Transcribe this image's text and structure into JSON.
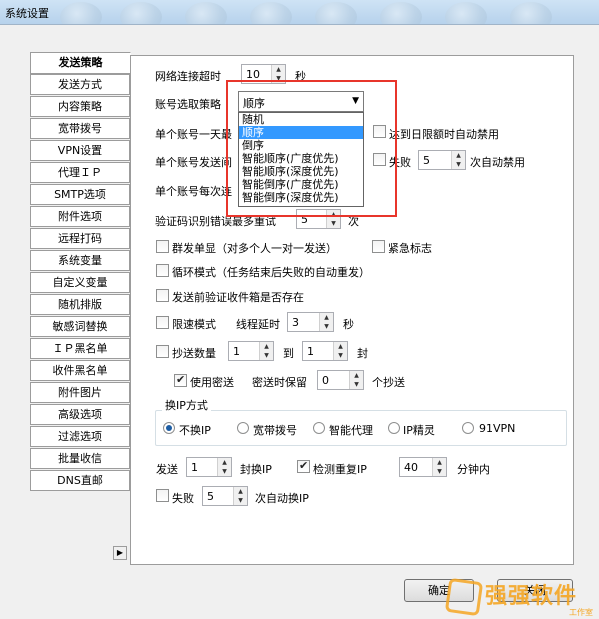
{
  "window": {
    "title": "系统设置"
  },
  "tabs": [
    "发送策略",
    "发送方式",
    "内容策略",
    "宽带拨号",
    "VPN设置",
    "代理ＩＰ",
    "SMTP选项",
    "附件选项",
    "远程打码",
    "系统变量",
    "自定义变量",
    "随机排版",
    "敏感词替换",
    "ＩＰ黑名单",
    "收件黑名单",
    "附件图片",
    "高级选项",
    "过滤选项",
    "批量收信",
    "DNS直邮"
  ],
  "tabs_scroll_icon": "▶",
  "form": {
    "timeout_label": "网络连接超时",
    "timeout_value": "10",
    "timeout_unit": "秒",
    "account_strategy_label": "账号选取策略",
    "account_strategy_value": "顺序",
    "account_strategy_options": [
      "随机",
      "顺序",
      "倒序",
      "智能顺序(广度优先)",
      "智能顺序(深度优先)",
      "智能倒序(广度优先)",
      "智能倒序(深度优先)"
    ],
    "per_day_label": "单个账号一天最",
    "per_day_limit_label": "达到日限额时自动禁用",
    "per_send_label": "单个账号发送间",
    "fail_label": "失败",
    "fail_value": "5",
    "fail_suffix": "次自动禁用",
    "per_connect_label": "单个账号每次连",
    "captcha_label": "验证码识别错误最多重试",
    "captcha_value": "5",
    "captcha_unit": "次",
    "group_single_label": "群发单显（对多个人一对一发送）",
    "urgent_label": "紧急标志",
    "loop_label": "循环模式（任务结束后失败的自动重发）",
    "verify_inbox_label": "发送前验证收件箱是否存在",
    "speed_limit_label": "限速模式",
    "thread_delay_label": "线程延时",
    "thread_delay_value": "3",
    "thread_delay_unit": "秒",
    "cc_count_label": "抄送数量",
    "cc_from": "1",
    "cc_to_label": "到",
    "cc_to": "1",
    "cc_unit": "封",
    "bcc_label": "使用密送",
    "bcc_keep_label": "密送时保留",
    "bcc_keep_value": "0",
    "bcc_keep_unit": "个抄送",
    "ip_mode_title": "换IP方式",
    "ip_modes": [
      "不换IP",
      "宽带拨号",
      "智能代理",
      "IP精灵",
      "91VPN"
    ],
    "send_label": "发送",
    "send_value": "1",
    "send_switch_label": "封换IP",
    "dup_ip_label": "检测重复IP",
    "dup_ip_value": "40",
    "dup_ip_unit": "分钟内",
    "fail2_label": "失败",
    "fail2_value": "5",
    "fail2_suffix": "次自动换IP"
  },
  "buttons": {
    "ok": "确定",
    "close": "关闭"
  },
  "watermark": {
    "text": "强强软件",
    "sub": "工作室"
  },
  "colors": {
    "selection": "#3399ff",
    "highlight_box": "#e8352b",
    "watermark": "#f5a623"
  }
}
